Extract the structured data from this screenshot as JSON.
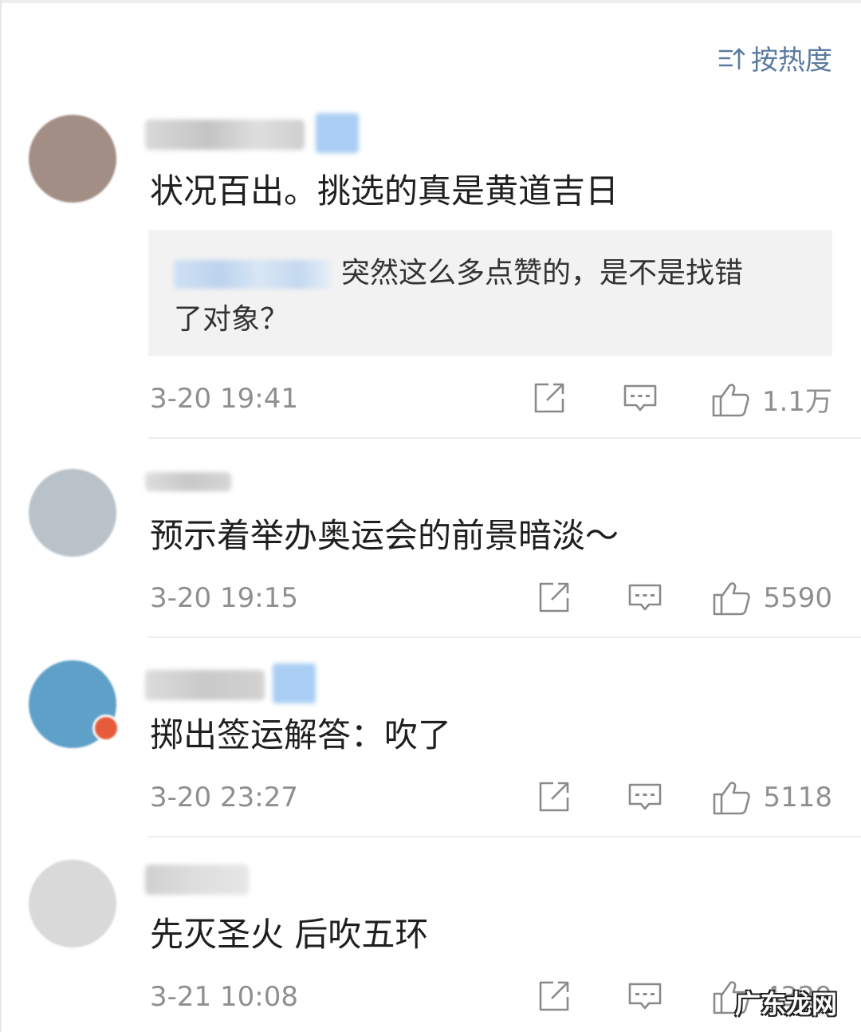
{
  "sort_label": "按热度",
  "comments": [
    {
      "text": "状况百出。挑选的真是黄道吉日",
      "reply_text_line1": "突然这么多点赞的，是不是找错",
      "reply_text_line2": "了对象？",
      "time": "3-20 19:41",
      "likes": "1.1万"
    },
    {
      "text": "预示着举办奥运会的前景暗淡～",
      "time": "3-20 19:15",
      "likes": "5590"
    },
    {
      "text": "掷出签运解答：吹了",
      "time": "3-20 23:27",
      "likes": "5118"
    },
    {
      "text": "先灭圣火 后吹五环",
      "time": "3-21 10:08",
      "likes": "4329"
    }
  ],
  "watermark": "广东龙网",
  "colors": {
    "link_blue": "#5b7aa0",
    "meta_gray": "#8f8f8f",
    "vip_blue": "#a9cdf3"
  }
}
